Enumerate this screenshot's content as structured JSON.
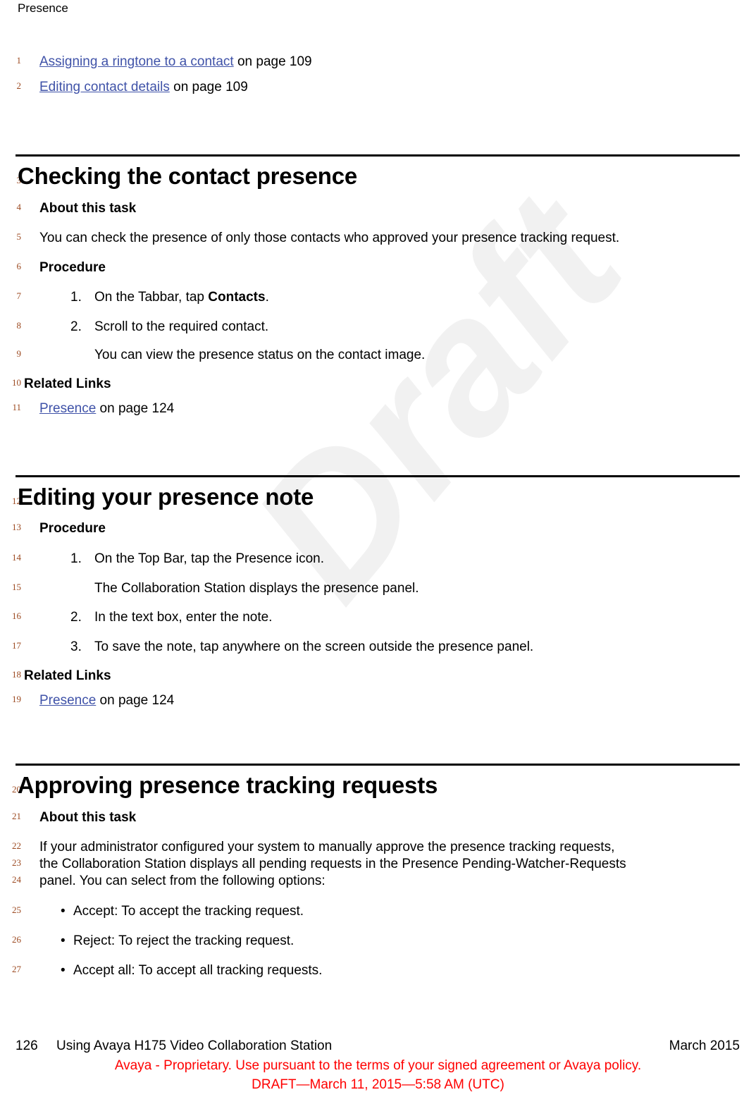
{
  "header": {
    "running_head": "Presence"
  },
  "watermark": {
    "text": "Draft"
  },
  "related_links_top": {
    "items": [
      {
        "line": "1",
        "link": "Assigning a ringtone to a contact",
        "suffix": " on page 109"
      },
      {
        "line": "2",
        "link": "Editing contact details",
        "suffix": " on page 109"
      }
    ]
  },
  "sections": [
    {
      "line": "3",
      "title": "Checking the contact presence",
      "about_label": {
        "line": "4",
        "text": "About this task"
      },
      "about_body": {
        "line": "5",
        "text": "You can check the presence of only those contacts who approved your presence tracking request."
      },
      "procedure_label": {
        "line": "6",
        "text": "Procedure"
      },
      "steps": [
        {
          "line": "7",
          "num": "1.",
          "text_before": "On the Tabbar, tap ",
          "bold": "Contacts",
          "text_after": "."
        },
        {
          "line": "8",
          "num": "2.",
          "text_before": "Scroll to the required contact.",
          "bold": "",
          "text_after": ""
        }
      ],
      "result": {
        "line": "9",
        "text": "You can view the presence status on the contact image."
      },
      "related_links_label": {
        "line": "10",
        "text": "Related Links"
      },
      "related_links": [
        {
          "line": "11",
          "link": "Presence",
          "suffix": " on page 124"
        }
      ]
    },
    {
      "line": "12",
      "title": "Editing your presence note",
      "procedure_label": {
        "line": "13",
        "text": "Procedure"
      },
      "steps": [
        {
          "line": "14",
          "num": "1.",
          "text": "On the Top Bar, tap the Presence icon."
        },
        {
          "line": "16",
          "num": "2.",
          "text": "In the text box, enter the note."
        },
        {
          "line": "17",
          "num": "3.",
          "text": "To save the note, tap anywhere on the screen outside the presence panel."
        }
      ],
      "step_result": {
        "line": "15",
        "text": "The Collaboration Station displays the presence panel."
      },
      "related_links_label": {
        "line": "18",
        "text": "Related Links"
      },
      "related_links": [
        {
          "line": "19",
          "link": "Presence",
          "suffix": " on page 124"
        }
      ]
    },
    {
      "line": "20",
      "title": "Approving presence tracking requests",
      "about_label": {
        "line": "21",
        "text": "About this task"
      },
      "paragraph_lines": [
        {
          "line": "22",
          "text": "If your administrator configured your system to manually approve the presence tracking requests,"
        },
        {
          "line": "23",
          "text": "the Collaboration Station displays all pending requests in the Presence Pending-Watcher-Requests"
        },
        {
          "line": "24",
          "text": "panel. You can select from the following options:"
        }
      ],
      "bullets": [
        {
          "line": "25",
          "bullet": "•",
          "text": "Accept: To accept the tracking request."
        },
        {
          "line": "26",
          "bullet": "•",
          "text": "Reject: To reject the tracking request."
        },
        {
          "line": "27",
          "bullet": "•",
          "text": "Accept all: To accept all tracking requests."
        }
      ]
    }
  ],
  "footer": {
    "page_number": "126",
    "document_title": "Using Avaya H175 Video Collaboration Station",
    "date": "March 2015",
    "proprietary": "Avaya - Proprietary. Use pursuant to the terms of your signed agreement or Avaya policy.",
    "draft_stamp": "DRAFT—March 11, 2015—5:58 AM (UTC)"
  },
  "colors": {
    "link": "#3f52a8",
    "line_number": "#9c4a21",
    "draft_red": "#ff0000",
    "watermark": "#f1f1f1"
  }
}
